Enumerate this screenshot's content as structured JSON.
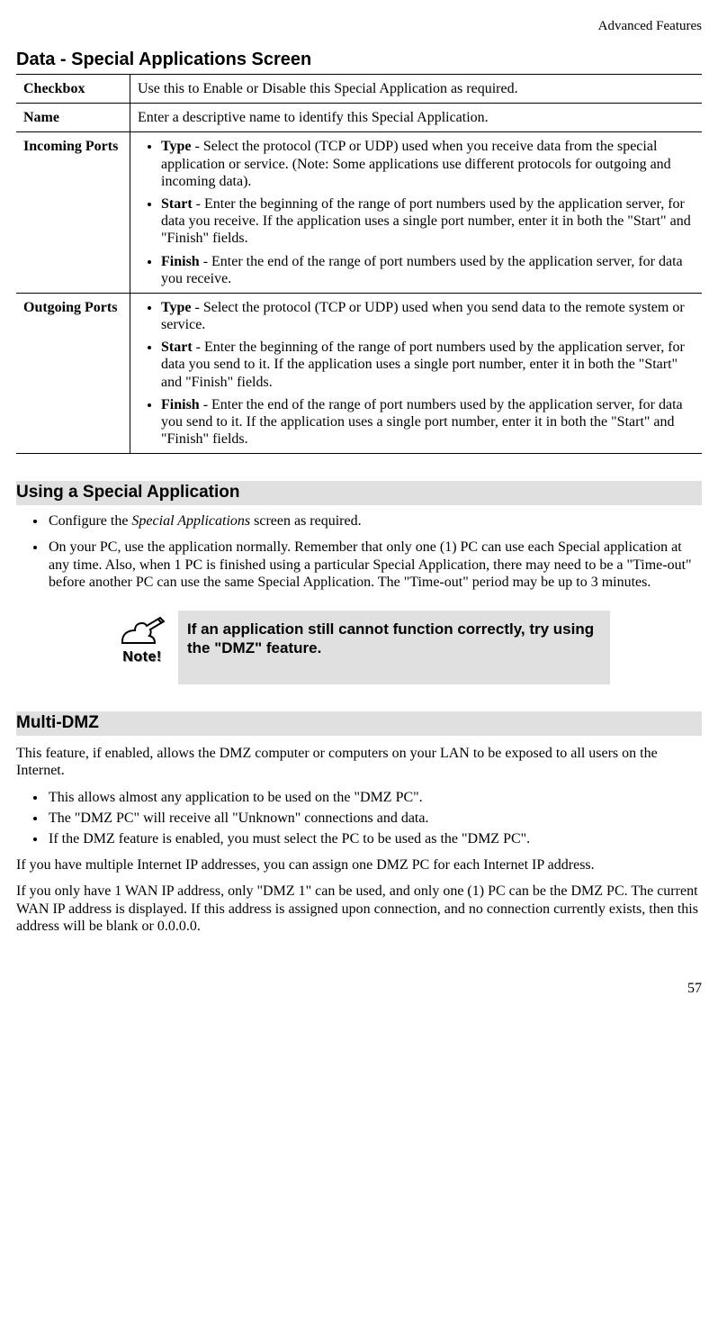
{
  "header": {
    "right": "Advanced Features"
  },
  "section1": {
    "title": "Data - Special Applications Screen",
    "rows": {
      "checkbox": {
        "label": "Checkbox",
        "desc": "Use this to Enable or Disable this Special Application as required."
      },
      "name": {
        "label": "Name",
        "desc": "Enter a descriptive name to identify this Special Application."
      },
      "incoming": {
        "label": "Incoming Ports",
        "items": {
          "type": {
            "b": "Type",
            "t": " - Select the protocol (TCP or UDP) used when you receive data from the special application or service. (Note: Some applications use different protocols for outgoing and incoming data)."
          },
          "start": {
            "b": "Start",
            "t": " - Enter the beginning of the range of port numbers used by the application server, for data you receive. If the application uses a single port number, enter it in both the \"Start\" and \"Finish\" fields."
          },
          "finish": {
            "b": "Finish",
            "t": " - Enter the end of the range of port numbers used by the application server, for data you receive."
          }
        }
      },
      "outgoing": {
        "label": "Outgoing Ports",
        "items": {
          "type": {
            "b": "Type",
            "t": " - Select the protocol (TCP or UDP) used when you send data to the remote system or service."
          },
          "start": {
            "b": "Start",
            "t": " - Enter the beginning of the range of port numbers used by the application server, for data you send to it. If the application uses a single port number, enter it in both the \"Start\" and \"Finish\" fields."
          },
          "finish": {
            "b": "Finish",
            "t": " - Enter the end of the range of port numbers used by the application server, for data you send to it. If the application uses a single port number, enter it in both the \"Start\" and \"Finish\" fields."
          }
        }
      }
    }
  },
  "section2": {
    "title": "Using a Special Application",
    "items": {
      "i1": {
        "pre": "Configure the ",
        "italic": "Special Applications",
        "post": " screen as required."
      },
      "i2": "On your PC, use the application normally. Remember that only one (1) PC can use each Special application at any time. Also, when 1 PC is finished using a particular Special Application, there may need to be a \"Time-out\" before another PC can use the same Special Application. The \"Time-out\" period may be up to 3 minutes."
    }
  },
  "note": {
    "label": "Note!",
    "text": "If an application still cannot function correctly, try using the \"DMZ\" feature."
  },
  "section3": {
    "title": "Multi-DMZ",
    "intro": "This feature, if enabled, allows the DMZ computer or computers on your LAN to be exposed to all users on the Internet.",
    "items": {
      "i1": "This allows almost any application to be used on the \"DMZ PC\".",
      "i2": "The \"DMZ PC\" will receive all \"Unknown\" connections and data.",
      "i3": "If the DMZ feature is enabled, you must select the PC to be used as the \"DMZ PC\"."
    },
    "p1": "If you have multiple Internet IP addresses, you can assign one DMZ PC for each Internet IP address.",
    "p2": "If you only have 1 WAN IP address, only \"DMZ 1\" can be used, and only one (1) PC can be the DMZ PC. The current WAN IP address is displayed. If this address is assigned upon connection, and no connection currently exists, then this address will be blank or 0.0.0.0."
  },
  "page_number": "57"
}
